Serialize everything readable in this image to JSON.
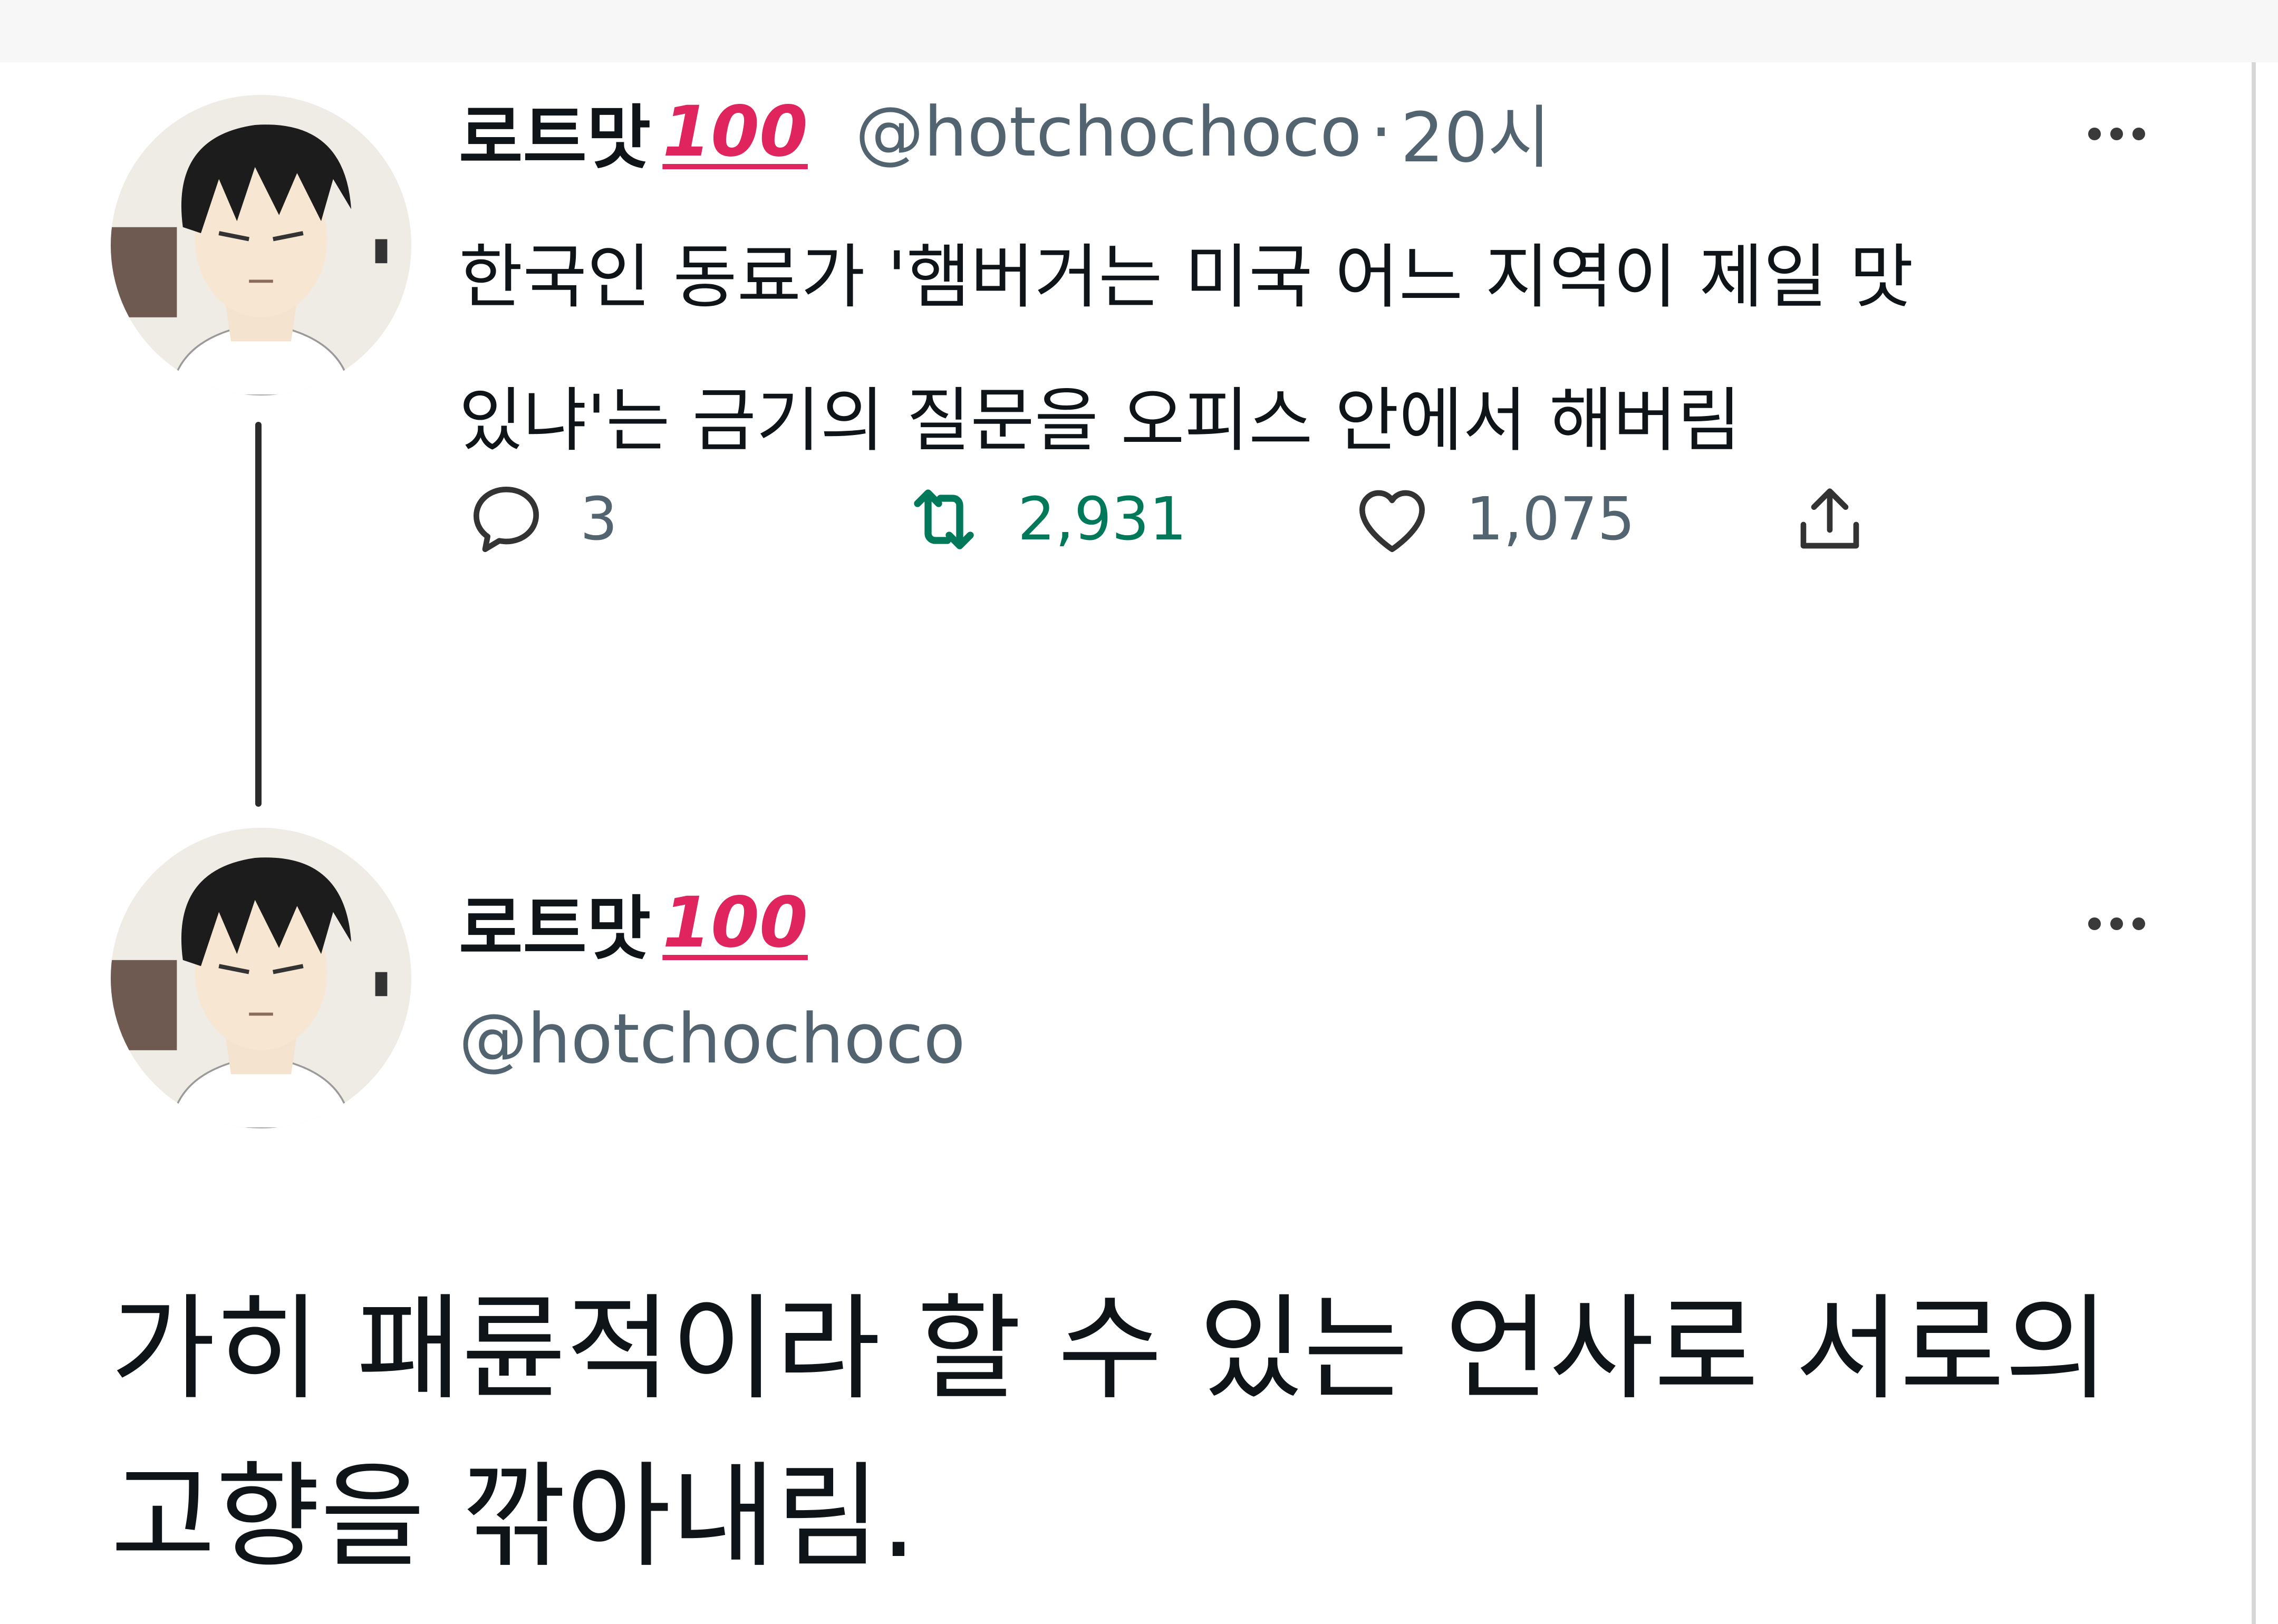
{
  "first_tweet": {
    "display_name": "로트맛",
    "emoji": "100",
    "handle": "@hotchochoco",
    "separator": "·",
    "time": "20시",
    "text_line1": "한국인 동료가 '햄버거는 미국 어느 지역이 제일 맛",
    "text_line2": "있냐'는 금기의 질문을 오피스 안에서 해버림",
    "actions": {
      "reply_count": "3",
      "retweet_count": "2,931",
      "like_count": "1,075"
    }
  },
  "second_tweet": {
    "display_name": "로트맛",
    "emoji": "100",
    "handle": "@hotchochoco",
    "text_line1": "가히 패륜적이라 할 수 있는 언사로 서로의",
    "text_line2": "고향을 깎아내림."
  },
  "colors": {
    "retweet_green": "#00795a",
    "emoji_red": "#e0245e",
    "secondary_text": "#536471"
  },
  "icons": [
    "reply-icon",
    "retweet-icon",
    "like-icon",
    "share-icon",
    "more-options-icon"
  ]
}
